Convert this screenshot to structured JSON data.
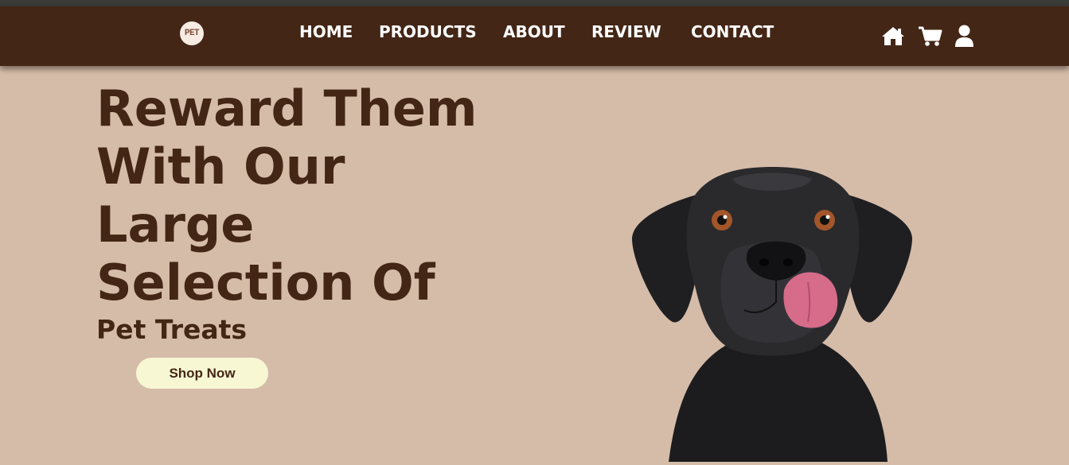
{
  "brand": {
    "logo_text": "PET"
  },
  "nav": {
    "links": [
      {
        "label": "HOME"
      },
      {
        "label": "PRODUCTS"
      },
      {
        "label": "ABOUT"
      },
      {
        "label": "REVIEW"
      },
      {
        "label": "CONTACT"
      }
    ],
    "icons": [
      "home-icon",
      "cart-icon",
      "user-icon"
    ]
  },
  "hero": {
    "title_lines": [
      "Reward Them",
      "With Our",
      "Large",
      "Selection Of"
    ],
    "subtitle": "Pet Treats",
    "cta_label": "Shop Now"
  },
  "colors": {
    "nav_bg": "#432616",
    "page_bg": "#d5bca8",
    "accent_text": "#432616",
    "button_bg": "#f7f7d3"
  }
}
